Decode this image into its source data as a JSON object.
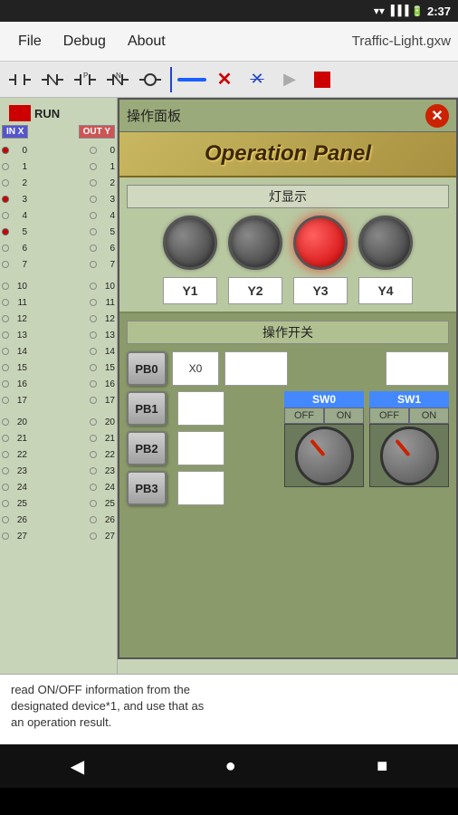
{
  "statusBar": {
    "time": "2:37",
    "icons": [
      "wifi",
      "signal",
      "battery"
    ]
  },
  "menuBar": {
    "file": "File",
    "debug": "Debug",
    "about": "About",
    "title": "Traffic-Light.gxw"
  },
  "toolbar": {
    "buttons": [
      "contact-no",
      "contact-nc",
      "contact-p",
      "contact-n",
      "coil",
      "divider",
      "line",
      "x-red",
      "x-blue",
      "play",
      "stop"
    ]
  },
  "leftPanel": {
    "runLabel": "RUN",
    "inxLabel": "IN X",
    "outyLabel": "OUT Y",
    "rows": [
      {
        "num": "0",
        "inDot": true,
        "outNum": "0",
        "outDot": false
      },
      {
        "num": "1",
        "inDot": false,
        "outNum": "1",
        "outDot": false
      },
      {
        "num": "2",
        "inDot": false,
        "outNum": "2",
        "outDot": false
      },
      {
        "num": "3",
        "inDot": true,
        "outNum": "3",
        "outDot": false
      },
      {
        "num": "4",
        "inDot": false,
        "outNum": "4",
        "outDot": false
      },
      {
        "num": "5",
        "inDot": true,
        "outNum": "5",
        "outDot": false
      },
      {
        "num": "6",
        "inDot": false,
        "outNum": "6",
        "outDot": false
      },
      {
        "num": "7",
        "inDot": false,
        "outNum": "7",
        "outDot": false
      },
      {
        "num": "10",
        "inDot": false,
        "outNum": "10",
        "outDot": false
      },
      {
        "num": "11",
        "inDot": false,
        "outNum": "11",
        "outDot": false
      },
      {
        "num": "12",
        "inDot": false,
        "outNum": "12",
        "outDot": false
      },
      {
        "num": "13",
        "inDot": false,
        "outNum": "13",
        "outDot": false
      },
      {
        "num": "14",
        "inDot": false,
        "outNum": "14",
        "outDot": false
      },
      {
        "num": "15",
        "inDot": false,
        "outNum": "15",
        "outDot": false
      },
      {
        "num": "16",
        "inDot": false,
        "outNum": "16",
        "outDot": false
      },
      {
        "num": "17",
        "inDot": false,
        "outNum": "17",
        "outDot": false
      },
      {
        "num": "20",
        "inDot": false,
        "outNum": "20",
        "outDot": false
      },
      {
        "num": "21",
        "inDot": false,
        "outNum": "21",
        "outDot": false
      },
      {
        "num": "22",
        "inDot": false,
        "outNum": "22",
        "outDot": false
      },
      {
        "num": "23",
        "inDot": false,
        "outNum": "23",
        "outDot": false
      },
      {
        "num": "24",
        "inDot": false,
        "outNum": "24",
        "outDot": false
      },
      {
        "num": "25",
        "inDot": false,
        "outNum": "25",
        "outDot": false
      },
      {
        "num": "26",
        "inDot": false,
        "outNum": "26",
        "outDot": false
      },
      {
        "num": "27",
        "inDot": false,
        "outNum": "27",
        "outDot": false
      }
    ]
  },
  "dialog": {
    "title": "操作面板",
    "closeBtn": "✕",
    "operationPanel": "Operation Panel",
    "lightSection": {
      "label": "灯显示",
      "lights": [
        {
          "id": "Y1",
          "state": "off"
        },
        {
          "id": "Y2",
          "state": "off"
        },
        {
          "id": "Y3",
          "state": "red"
        },
        {
          "id": "Y4",
          "state": "off"
        }
      ]
    },
    "switchSection": {
      "label": "操作开关",
      "rows": [
        {
          "pb": "PB0",
          "input": "X0",
          "box1": "",
          "box2": ""
        },
        {
          "pb": "PB1",
          "input": "",
          "sw": "SW0"
        },
        {
          "pb": "PB2",
          "input": ""
        },
        {
          "pb": "PB3",
          "input": ""
        }
      ],
      "sw0Label": "SW0",
      "sw1Label": "SW1",
      "offLabel": "OFF",
      "onLabel": "ON"
    }
  },
  "bottomText": {
    "line1": "read ON/OFF information from the",
    "line2": "designated device*1, and use that as",
    "line3": "an operation result."
  },
  "navBar": {
    "back": "◀",
    "home": "●",
    "recent": "■"
  }
}
